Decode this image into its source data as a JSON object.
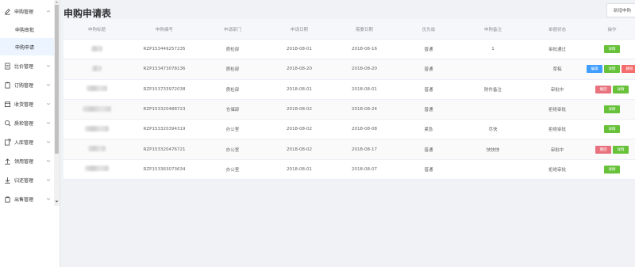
{
  "sidebar": {
    "items": [
      {
        "label": "申购管理",
        "icon": "edit-icon",
        "expanded": true
      },
      {
        "label": "比价管理",
        "icon": "document-icon"
      },
      {
        "label": "订购管理",
        "icon": "clipboard-icon"
      },
      {
        "label": "收货管理",
        "icon": "receive-icon"
      },
      {
        "label": "质检管理",
        "icon": "search-icon"
      },
      {
        "label": "入库管理",
        "icon": "inbox-icon"
      },
      {
        "label": "领用管理",
        "icon": "upload-icon"
      },
      {
        "label": "归还管理",
        "icon": "download-icon"
      },
      {
        "label": "出售管理",
        "icon": "cart-icon"
      }
    ],
    "sub_items": [
      {
        "label": "申购审批"
      },
      {
        "label": "申购申请",
        "active": true
      }
    ]
  },
  "page": {
    "title": "申购申请表",
    "new_button": "新增申购"
  },
  "table": {
    "columns": [
      "申购标题",
      "申购编号",
      "申请部门",
      "申请日期",
      "需要日期",
      "优先级",
      "申购备注",
      "单据状态",
      "操作"
    ],
    "rows": [
      {
        "code": "RZP153449257235",
        "dept": "质检部",
        "apply_date": "2018-08-01",
        "need_date": "2018-08-16",
        "priority": "普通",
        "remark": "1",
        "status": "审批通过",
        "actions": [
          {
            "label": "详情",
            "color": "green"
          }
        ]
      },
      {
        "code": "RZP153473078136",
        "dept": "质检部",
        "apply_date": "2018-08-20",
        "need_date": "2018-08-20",
        "priority": "普通",
        "remark": "",
        "status": "草稿",
        "actions": [
          {
            "label": "编辑",
            "color": "blue"
          },
          {
            "label": "详情",
            "color": "green"
          },
          {
            "label": "删除",
            "color": "red"
          }
        ]
      },
      {
        "code": "RZP153733972038",
        "dept": "质检部",
        "apply_date": "2018-08-01",
        "need_date": "2018-08-01",
        "priority": "普通",
        "remark": "附件备注",
        "status": "审批中",
        "actions": [
          {
            "label": "撤回",
            "color": "rose"
          },
          {
            "label": "详情",
            "color": "green"
          }
        ]
      },
      {
        "code": "RZP153320488723",
        "dept": "仓储部",
        "apply_date": "2018-08-02",
        "need_date": "2018-08-24",
        "priority": "普通",
        "remark": "",
        "status": "拒绝审批",
        "actions": [
          {
            "label": "详情",
            "color": "green"
          }
        ]
      },
      {
        "code": "RZP153320394319",
        "dept": "办公室",
        "apply_date": "2018-08-02",
        "need_date": "2018-08-08",
        "priority": "紧急",
        "remark": "尽快",
        "status": "拒绝审批",
        "actions": [
          {
            "label": "详情",
            "color": "green"
          }
        ]
      },
      {
        "code": "RZP153320476721",
        "dept": "办公室",
        "apply_date": "2018-08-02",
        "need_date": "2018-08-17",
        "priority": "普通",
        "remark": "快快快",
        "status": "审批中",
        "actions": [
          {
            "label": "撤回",
            "color": "rose"
          },
          {
            "label": "详情",
            "color": "green"
          }
        ]
      },
      {
        "code": "RZP153363073634",
        "dept": "办公室",
        "apply_date": "2018-08-01",
        "need_date": "2018-08-07",
        "priority": "普通",
        "remark": "",
        "status": "拒绝审批",
        "actions": [
          {
            "label": "详情",
            "color": "green"
          }
        ]
      }
    ]
  }
}
